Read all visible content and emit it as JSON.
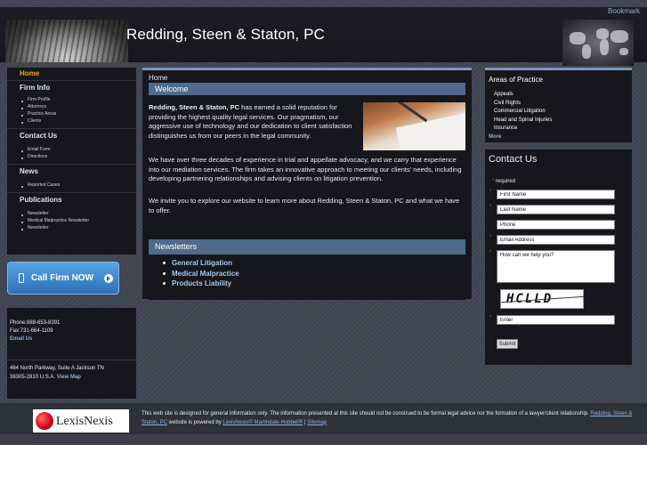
{
  "header": {
    "firm_title": "Redding, Steen & Staton, PC",
    "bookmark": "Bookmark"
  },
  "leftnav": {
    "home": "Home",
    "sections": [
      {
        "title": "Firm Info",
        "items": [
          "Firm Profile",
          "Attorneys",
          "Practice Areas",
          "Clients"
        ]
      },
      {
        "title": "Contact Us",
        "items": [
          "Email Form",
          "Directions"
        ]
      },
      {
        "title": "News",
        "items": [
          "Reported Cases"
        ]
      },
      {
        "title": "Publications",
        "items": [
          "Newsletter",
          "Medical Malpractice Newsletter",
          "Newsletter"
        ]
      }
    ]
  },
  "call_button": {
    "label": "Call Firm NOW"
  },
  "contact_box": {
    "phone": "Phone:888-653-8391",
    "fax": "Fax:731-664-1109",
    "email": "Email Us",
    "address": "464 North Parkway, Suite A Jackson TN",
    "address2": "38305-2810 U.S.A.",
    "map": "View Map"
  },
  "main": {
    "breadcrumb": "Home",
    "heading": "Welcome",
    "p1_bold": "Redding, Steen & Staton, PC",
    "p1_rest": " has earned a solid reputation for providing the highest quality legal services. Our pragmatism, our aggressive use of technology and our dedication to client satisfaction distinguishes us from our peers in the legal community.",
    "p2": "We have over three decades of experience in trial and appellate advocacy, and we carry that experience into our mediation services. The firm takes an innovative approach to meeting our clients' needs, including developing partnering relationships and advising clients on litigation prevention.",
    "p3": "We invite you to explore our website to learn more about Redding, Steen & Staton, PC and what we have to offer."
  },
  "newsletters": {
    "heading": "Newsletters",
    "items": [
      "General Litigation",
      "Medical Malpractice",
      "Products Liability"
    ]
  },
  "practice": {
    "heading": "Areas of Practice",
    "items": [
      "Appeals",
      "Civil Rights",
      "Commercial Litigation",
      "Head and Spinal Injuries",
      "Insurance"
    ],
    "more": "More"
  },
  "contact_form": {
    "heading": "Contact Us",
    "required": "required",
    "first_name": "First Name",
    "last_name": "Last Name",
    "phone": "Phone",
    "email": "Email Address",
    "message": "How can we help you?",
    "captcha": "HCLLD",
    "enter": "Enter",
    "submit": "Submit"
  },
  "footer": {
    "logo_text": "LexisNexis",
    "text1": "This web site is designed for general information only. The information presented at this site should not be construed to be formal legal advice nor the formation of a lawyer/client relationship. ",
    "link1": "Redding, Steen & Staton, PC",
    "text2": " website is powered by ",
    "link2": "LexisNexis® Martindale-Hubbell®",
    "text3": " | ",
    "link3": "Sitemap"
  }
}
